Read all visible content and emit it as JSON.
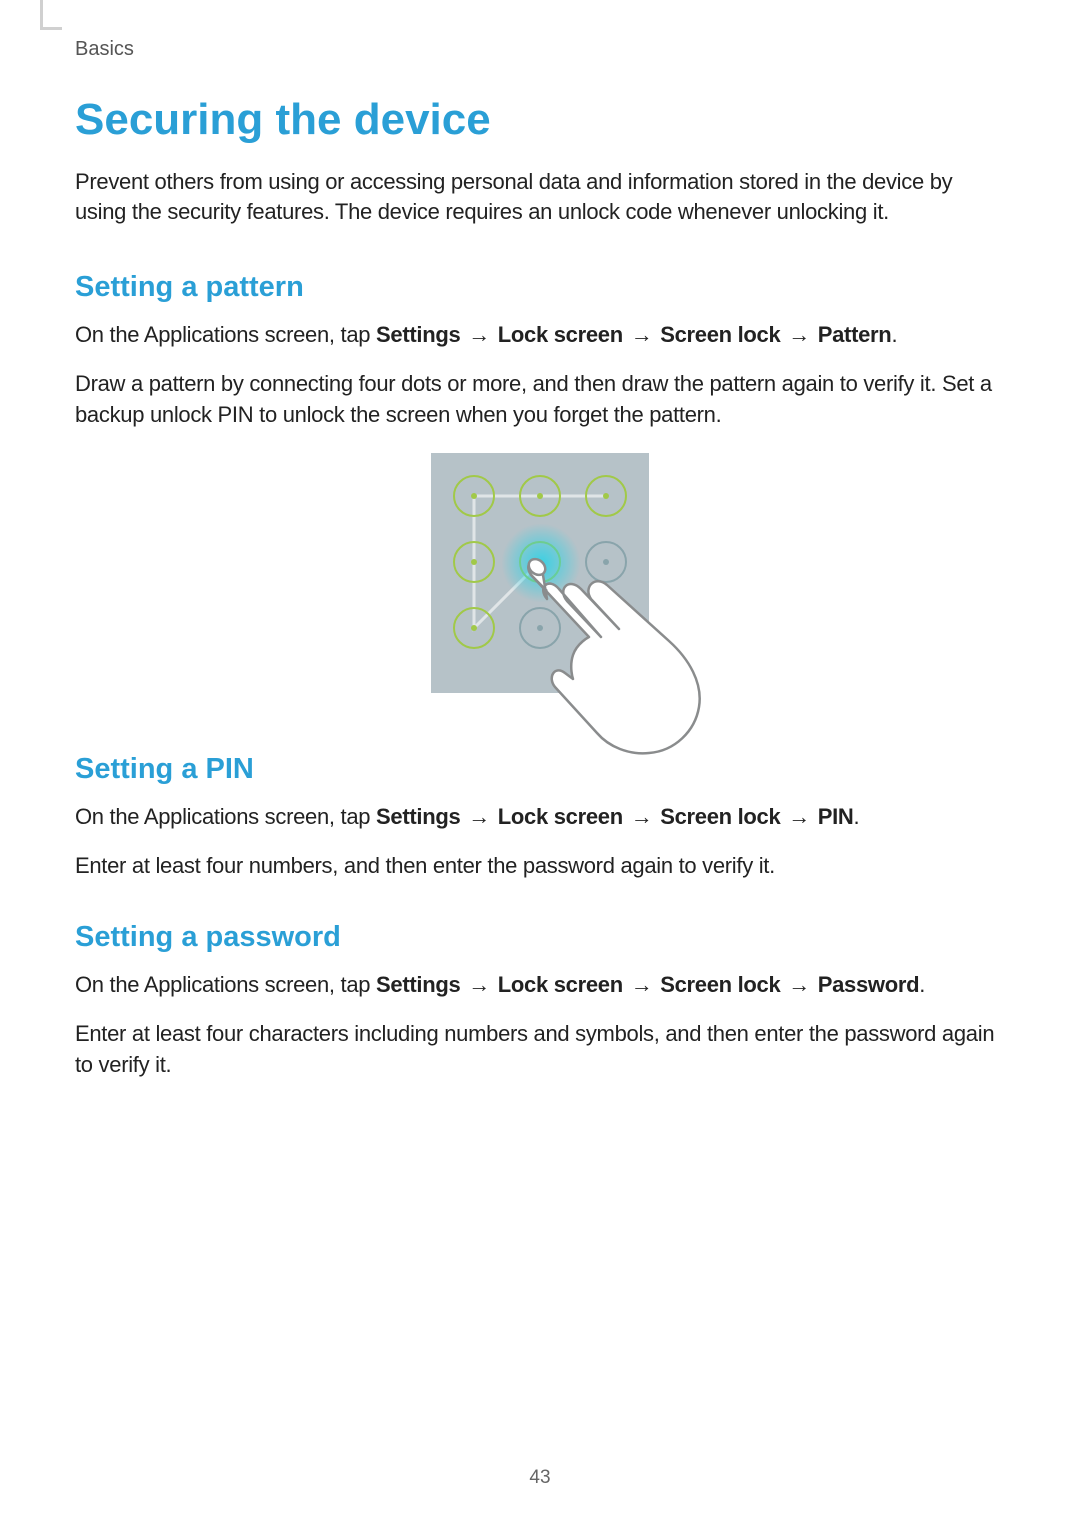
{
  "breadcrumb": "Basics",
  "page": {
    "title": "Securing the device",
    "intro": "Prevent others from using or accessing personal data and information stored in the device by using the security features. The device requires an unlock code whenever unlocking it."
  },
  "sections": {
    "pattern": {
      "heading": "Setting a pattern",
      "nav_prefix": "On the Applications screen, tap ",
      "nav_items": [
        "Settings",
        "Lock screen",
        "Screen lock",
        "Pattern"
      ],
      "body": "Draw a pattern by connecting four dots or more, and then draw the pattern again to verify it. Set a backup unlock PIN to unlock the screen when you forget the pattern."
    },
    "pin": {
      "heading": "Setting a PIN",
      "nav_prefix": "On the Applications screen, tap ",
      "nav_items": [
        "Settings",
        "Lock screen",
        "Screen lock",
        "PIN"
      ],
      "body": "Enter at least four numbers, and then enter the password again to verify it."
    },
    "password": {
      "heading": "Setting a password",
      "nav_prefix": "On the Applications screen, tap ",
      "nav_items": [
        "Settings",
        "Lock screen",
        "Screen lock",
        "Password"
      ],
      "body": "Enter at least four characters including numbers and symbols, and then enter the password again to verify it."
    }
  },
  "arrow_glyph": "→",
  "page_number": "43"
}
